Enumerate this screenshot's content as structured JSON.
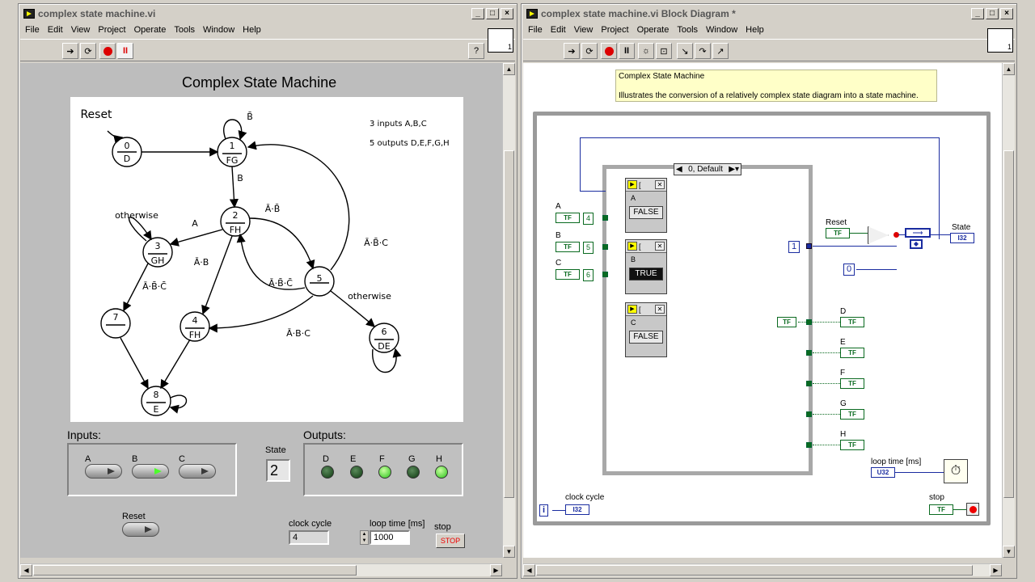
{
  "front_panel": {
    "title": "complex state machine.vi",
    "menu": [
      "File",
      "Edit",
      "View",
      "Project",
      "Operate",
      "Tools",
      "Window",
      "Help"
    ],
    "heading": "Complex State Machine",
    "inputs_label": "Inputs:",
    "outputs_label": "Outputs:",
    "inputs": [
      {
        "label": "A",
        "on": false
      },
      {
        "label": "B",
        "on": true
      },
      {
        "label": "C",
        "on": false
      }
    ],
    "outputs": [
      {
        "label": "D",
        "on": false
      },
      {
        "label": "E",
        "on": false
      },
      {
        "label": "F",
        "on": true
      },
      {
        "label": "G",
        "on": false
      },
      {
        "label": "H",
        "on": true
      }
    ],
    "state_label": "State",
    "state_value": "2",
    "reset_label": "Reset",
    "clock_cycle_label": "clock cycle",
    "clock_cycle_value": "4",
    "loop_time_label": "loop time [ms]",
    "loop_time_value": "1000",
    "stop_label": "stop",
    "stop_button": "STOP",
    "connector_num": "1"
  },
  "state_diagram": {
    "reset": "Reset",
    "info": [
      "3 inputs A,B,C",
      "5 outputs D,E,F,G,H"
    ],
    "states": [
      {
        "num": "0",
        "out": "D"
      },
      {
        "num": "1",
        "out": "FG"
      },
      {
        "num": "2",
        "out": "FH"
      },
      {
        "num": "3",
        "out": "GH"
      },
      {
        "num": "4",
        "out": "FH"
      },
      {
        "num": "5",
        "out": ""
      },
      {
        "num": "6",
        "out": "DE"
      },
      {
        "num": "7",
        "out": ""
      },
      {
        "num": "8",
        "out": "E"
      }
    ],
    "transitions": {
      "t1_self": "B̄",
      "t1_2": "B",
      "t2_3": "A",
      "t2_5": "Ā·B̄",
      "t2_4": "Ā·B",
      "t3_self": "otherwise",
      "t3_7": "Ā·B̄·C̄",
      "t5_2": "Ā·B̄·C̄",
      "t5_1": "Ā·B̄·C",
      "t5_4": "Ā·B·C",
      "t5_6": "otherwise"
    }
  },
  "block_diagram": {
    "title": "complex state machine.vi Block Diagram *",
    "menu": [
      "File",
      "Edit",
      "View",
      "Project",
      "Operate",
      "Tools",
      "Window",
      "Help"
    ],
    "comment_title": "Complex State Machine",
    "comment_body": "Illustrates the conversion of a relatively complex state diagram into a state machine.",
    "case_selector": "0, Default",
    "inputs": [
      {
        "label": "A",
        "index": "4"
      },
      {
        "label": "B",
        "index": "5"
      },
      {
        "label": "C",
        "index": "6"
      }
    ],
    "probes": [
      {
        "title": "[",
        "name": "A",
        "value": "FALSE"
      },
      {
        "title": "[",
        "name": "B",
        "value": "TRUE"
      },
      {
        "title": "[",
        "name": "C",
        "value": "FALSE"
      }
    ],
    "outputs": [
      "D",
      "E",
      "F",
      "G",
      "H"
    ],
    "reset_label": "Reset",
    "state_label": "State",
    "state_type": "I32",
    "const_one": "1",
    "const_zero": "0",
    "tf": "TF",
    "loop_time_label": "loop time [ms]",
    "loop_time_type": "U32",
    "clock_cycle_label": "clock cycle",
    "clock_cycle_type": "I32",
    "iter": "i",
    "stop_label": "stop",
    "connector_num": "1"
  }
}
